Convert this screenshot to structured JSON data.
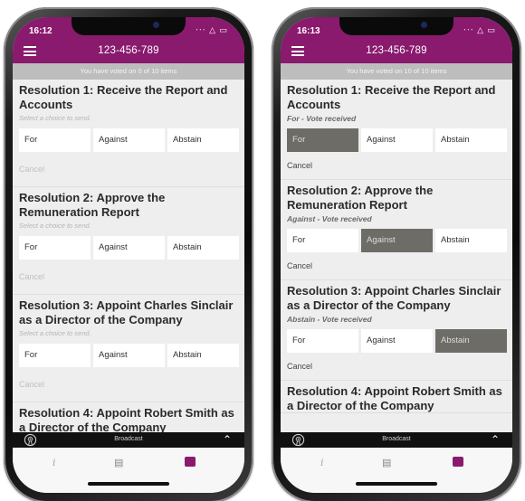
{
  "colors": {
    "accent": "#8a1a6e",
    "selected": "#6d6c66"
  },
  "phones": [
    {
      "time": "16:12",
      "signal": "‧‧‧ △ ▭",
      "title": "123-456-789",
      "vote_status": "You have voted on 0 of 10 items",
      "resolutions": [
        {
          "title": "Resolution 1: Receive the Report and Accounts",
          "hint": "Select a choice to send.",
          "choices": [
            "For",
            "Against",
            "Abstain"
          ],
          "selected": null,
          "cancel": "Cancel"
        },
        {
          "title": "Resolution 2: Approve the Remuneration Report",
          "hint": "Select a choice to send.",
          "choices": [
            "For",
            "Against",
            "Abstain"
          ],
          "selected": null,
          "cancel": "Cancel"
        },
        {
          "title": "Resolution 3: Appoint Charles Sinclair as a Director of the Company",
          "hint": "Select a choice to send.",
          "choices": [
            "For",
            "Against",
            "Abstain"
          ],
          "selected": null,
          "cancel": "Cancel"
        },
        {
          "title": "Resolution 4: Appoint Robert Smith as a Director of the Company",
          "hint": "",
          "choices": [],
          "selected": null,
          "cancel": ""
        }
      ],
      "broadcast": "Broadcast"
    },
    {
      "time": "16:13",
      "signal": "‧‧‧ △ ▭",
      "title": "123-456-789",
      "vote_status": "You have voted on 10 of 10 items",
      "resolutions": [
        {
          "title": "Resolution 1: Receive the Report and Accounts",
          "hint": "For - Vote received",
          "choices": [
            "For",
            "Against",
            "Abstain"
          ],
          "selected": 0,
          "cancel": "Cancel"
        },
        {
          "title": "Resolution 2: Approve the Remuneration Report",
          "hint": "Against  - Vote received",
          "choices": [
            "For",
            "Against",
            "Abstain"
          ],
          "selected": 1,
          "cancel": "Cancel"
        },
        {
          "title": "Resolution 3: Appoint Charles Sinclair as a Director of the Company",
          "hint": "Abstain - Vote received",
          "choices": [
            "For",
            "Against",
            "Abstain"
          ],
          "selected": 2,
          "cancel": "Cancel"
        },
        {
          "title": "Resolution 4: Appoint Robert Smith as a Director of the Company",
          "hint": "",
          "choices": [],
          "selected": null,
          "cancel": ""
        }
      ],
      "broadcast": "Broadcast"
    }
  ]
}
